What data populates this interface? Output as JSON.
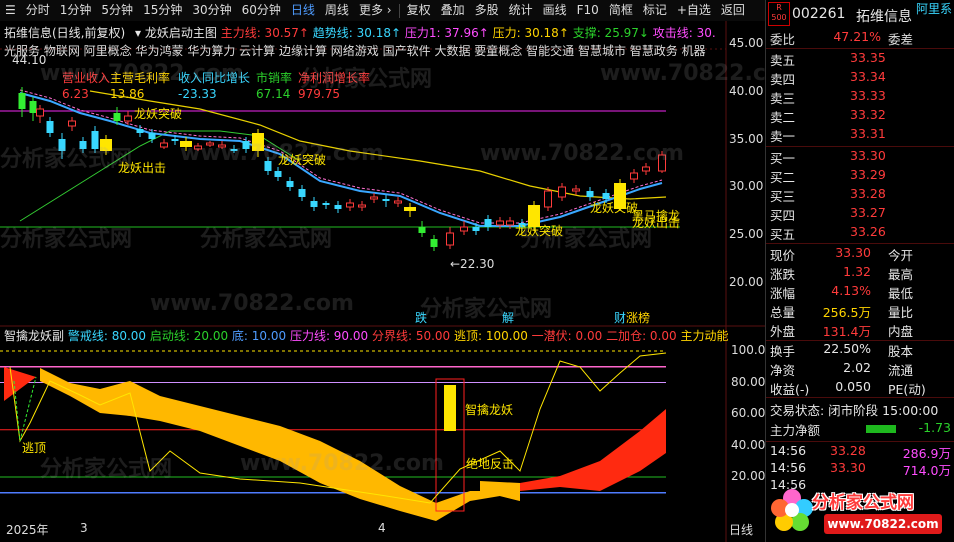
{
  "toolbar": {
    "left_items": [
      "分时",
      "1分钟",
      "5分钟",
      "15分钟",
      "30分钟",
      "60分钟",
      "日线",
      "周线",
      "更多 ›"
    ],
    "active": "日线",
    "right_items": [
      "复权",
      "叠加",
      "多股",
      "统计",
      "画线",
      "F10",
      "简框",
      "标记",
      "+自选",
      "返回"
    ]
  },
  "main_chart": {
    "title": "拓维信息(日线,前复权)",
    "indicator_name": "龙妖启动主图",
    "readouts": [
      {
        "label": "主力线: 30.57",
        "arrow": "↑",
        "color": "#ff3b3b"
      },
      {
        "label": "趋势线: 30.18",
        "arrow": "↑",
        "color": "#39d7ff"
      },
      {
        "label": "压力1: 37.96",
        "arrow": "↑",
        "color": "#ff4dff"
      },
      {
        "label": "压力: 30.18",
        "arrow": "↑",
        "color": "#ffd400"
      },
      {
        "label": "支撑: 25.97",
        "arrow": "↓",
        "color": "#2bd02b"
      },
      {
        "label": "攻击线: 30.",
        "arrow": "",
        "color": "#ff4dff"
      }
    ],
    "concepts": [
      "光服务",
      "物联网",
      "阿里概念",
      "华为鸿蒙",
      "华为算力",
      "云计算",
      "边缘计算",
      "网络游戏",
      "国产软件",
      "大数据",
      "要童概念",
      "智能交通",
      "智慧城市",
      "智慧政务",
      "机器"
    ],
    "fin_labels": [
      "营业收入",
      "主营毛利率",
      "收入同比增长",
      "市销率",
      "净利润增长率"
    ],
    "fin_values": [
      "6.23",
      "13.86",
      "-23.33",
      "67.14",
      "979.75"
    ],
    "fin_colors": [
      "#ff3b3b",
      "#ffd400",
      "#39d7ff",
      "#2bd02b",
      "#ff3b3b"
    ],
    "y_ticks": [
      "45.00",
      "40.00",
      "35.00",
      "30.00",
      "25.00",
      "20.00"
    ],
    "high_label": "44.10",
    "low_label": "←22.30",
    "annotations": [
      "龙妖突破",
      "龙妖出击",
      "龙妖突破",
      "龙妖突破",
      "龙妖突破",
      "黑马擒龙",
      "龙妖出击"
    ],
    "event_marks": [
      "跌",
      "解",
      "财",
      "涨榜"
    ]
  },
  "sub_chart": {
    "name": "智擒龙妖副",
    "readouts": [
      {
        "label": "警戒线: 80.00",
        "color": "#39d7ff"
      },
      {
        "label": "启动线: 20.00",
        "color": "#2bd02b"
      },
      {
        "label": "底: 10.00",
        "color": "#4f9cff"
      },
      {
        "label": "压力线: 90.00",
        "color": "#ff4dff"
      },
      {
        "label": "分界线: 50.00",
        "color": "#ff3b3b"
      },
      {
        "label": "逃顶: 100.00",
        "color": "#ffd400"
      },
      {
        "label": "一潜伏: 0.00",
        "color": "#ff3b3b"
      },
      {
        "label": "二加仓: 0.00",
        "color": "#ff3b3b"
      },
      {
        "label": "主力动能",
        "color": "#ffd400"
      }
    ],
    "y_ticks": [
      "100.0",
      "80.00",
      "60.00",
      "40.00",
      "20.00"
    ],
    "labels": [
      "逃顶",
      "智擒龙妖",
      "绝地反击"
    ]
  },
  "x_axis": [
    "2025年",
    "3",
    "4"
  ],
  "x_right_label": "日线",
  "quote": {
    "code": "002261",
    "name": "拓维信息",
    "badge_top": "R",
    "badge_bottom": "500",
    "tag": "阿里系",
    "weibi_label": "委比",
    "weibi_value": "47.21%",
    "weicha_label": "委差",
    "asks": [
      {
        "label": "卖五",
        "price": "33.35"
      },
      {
        "label": "卖四",
        "price": "33.34"
      },
      {
        "label": "卖三",
        "price": "33.33"
      },
      {
        "label": "卖二",
        "price": "33.32"
      },
      {
        "label": "卖一",
        "price": "33.31"
      }
    ],
    "bids": [
      {
        "label": "买一",
        "price": "33.30"
      },
      {
        "label": "买二",
        "price": "33.29"
      },
      {
        "label": "买三",
        "price": "33.28"
      },
      {
        "label": "买四",
        "price": "33.27"
      },
      {
        "label": "买五",
        "price": "33.26"
      }
    ],
    "stats": [
      {
        "label": "现价",
        "value": "33.30",
        "label2": "今开",
        "color": "#ff3b3b"
      },
      {
        "label": "涨跌",
        "value": "1.32",
        "label2": "最高",
        "color": "#ff3b3b"
      },
      {
        "label": "涨幅",
        "value": "4.13%",
        "label2": "最低",
        "color": "#ff3b3b"
      },
      {
        "label": "总量",
        "value": "256.5万",
        "label2": "量比",
        "color": "#ffd400"
      },
      {
        "label": "外盘",
        "value": "131.4万",
        "label2": "内盘",
        "color": "#ff3b3b"
      }
    ],
    "stats2": [
      {
        "label": "换手",
        "value": "22.50%",
        "label2": "股本"
      },
      {
        "label": "净资",
        "value": "2.02",
        "label2": "流通"
      },
      {
        "label": "收益(-)",
        "value": "0.050",
        "label2": "PE(动)"
      }
    ],
    "trade_status": "交易状态: 闭市阶段 15:00:00",
    "main_net_label": "主力净额",
    "main_net_value": "-1.73",
    "ticks": [
      {
        "time": "14:56",
        "price": "33.28",
        "vol": "286.9万"
      },
      {
        "time": "14:56",
        "price": "33.30",
        "vol": "714.0万"
      },
      {
        "time": "14:56",
        "price": "",
        "vol": ""
      }
    ]
  },
  "watermark": "分析家公式网",
  "logo_text": "分析家公式网",
  "logo_url": "www.70822.com",
  "wm_text": "www.70822.com"
}
